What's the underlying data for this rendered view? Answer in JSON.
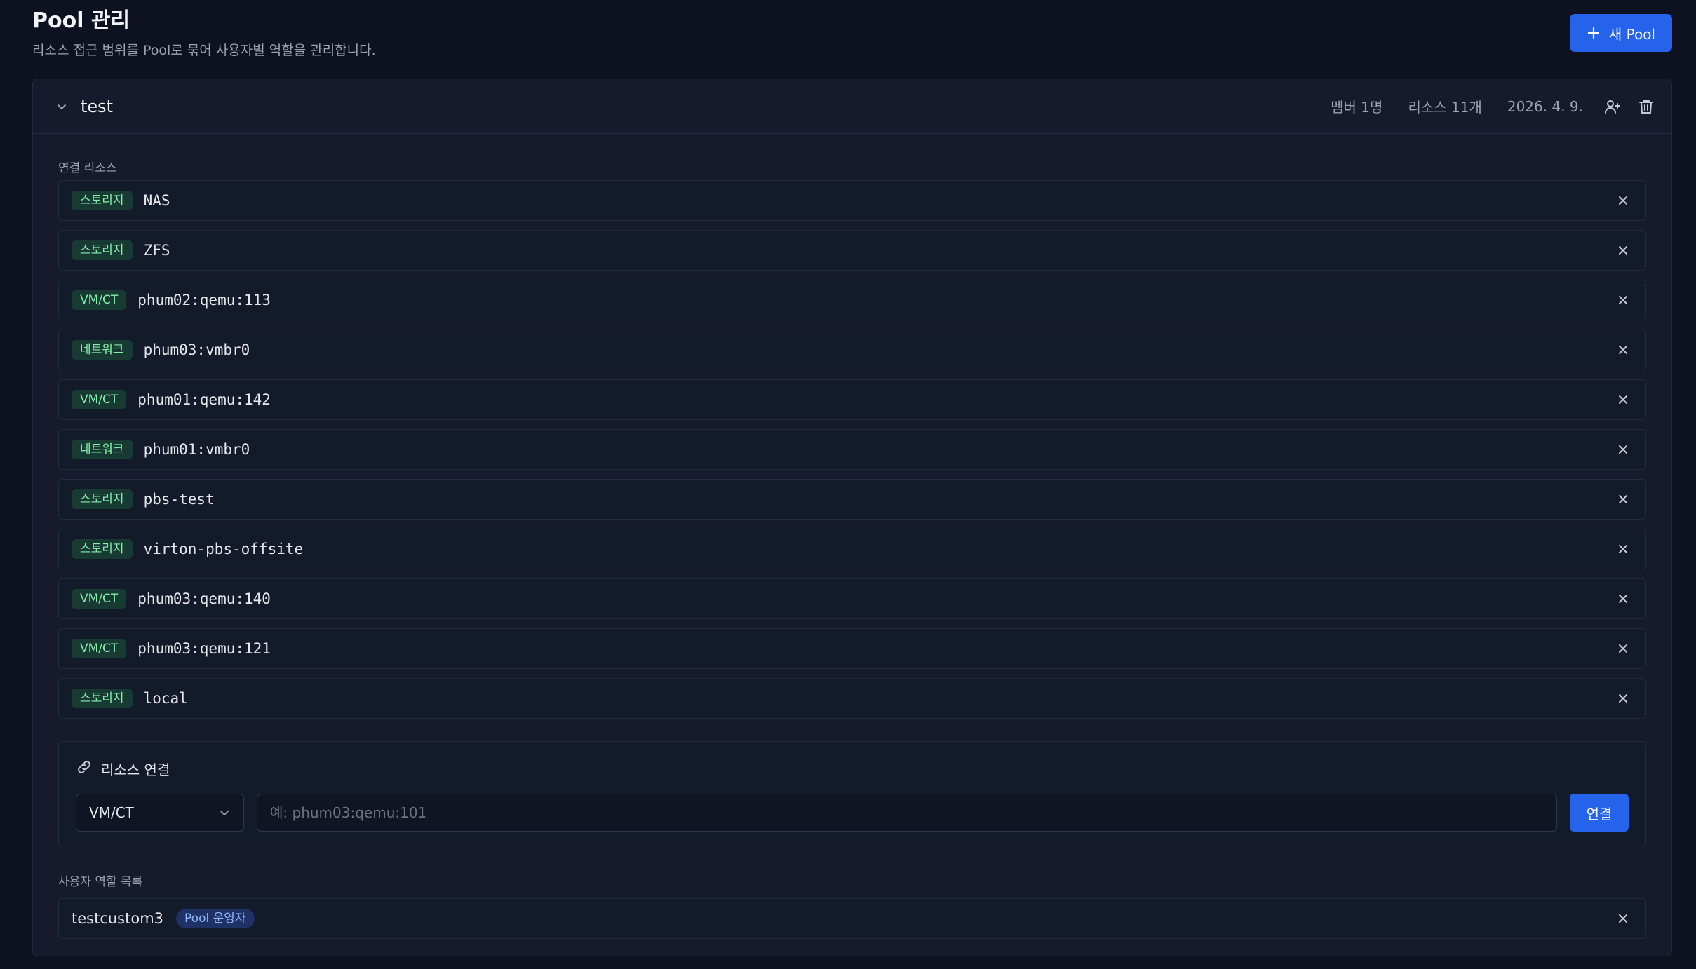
{
  "header": {
    "title": "Pool 관리",
    "subtitle": "리소스 접근 범위를 Pool로 묶어 사용자별 역할을 관리합니다.",
    "new_pool_label": "새 Pool"
  },
  "pool": {
    "name": "test",
    "members": "멤버 1명",
    "resources_count": "리소스 11개",
    "date": "2026. 4. 9.",
    "resources_section_label": "연결 리소스",
    "resources": [
      {
        "type": "스토리지",
        "name": "NAS"
      },
      {
        "type": "스토리지",
        "name": "ZFS"
      },
      {
        "type": "VM/CT",
        "name": "phum02:qemu:113"
      },
      {
        "type": "네트워크",
        "name": "phum03:vmbr0"
      },
      {
        "type": "VM/CT",
        "name": "phum01:qemu:142"
      },
      {
        "type": "네트워크",
        "name": "phum01:vmbr0"
      },
      {
        "type": "스토리지",
        "name": "pbs-test"
      },
      {
        "type": "스토리지",
        "name": "virton-pbs-offsite"
      },
      {
        "type": "VM/CT",
        "name": "phum03:qemu:140"
      },
      {
        "type": "VM/CT",
        "name": "phum03:qemu:121"
      },
      {
        "type": "스토리지",
        "name": "local"
      }
    ],
    "connect": {
      "title": "리소스 연결",
      "selected_type": "VM/CT",
      "input_value": "",
      "input_placeholder": "예: phum03:qemu:101",
      "button_label": "연결"
    },
    "users_section_label": "사용자 역할 목록",
    "users": [
      {
        "name": "testcustom3",
        "role": "Pool 운영자"
      }
    ]
  },
  "colors": {
    "accent": "#2563eb",
    "background": "#0d1120",
    "card": "#151b2c",
    "badge_bg": "#173a32",
    "badge_text": "#86efac",
    "role_bg": "#1e3266",
    "role_text": "#93b4ff"
  },
  "icons": {
    "new_pool": "plus-icon",
    "toggle": "chevron-down-icon",
    "add_member": "user-plus-icon",
    "delete": "trash-icon",
    "remove": "close-icon",
    "connect": "link-icon",
    "select": "chevron-down-icon"
  }
}
